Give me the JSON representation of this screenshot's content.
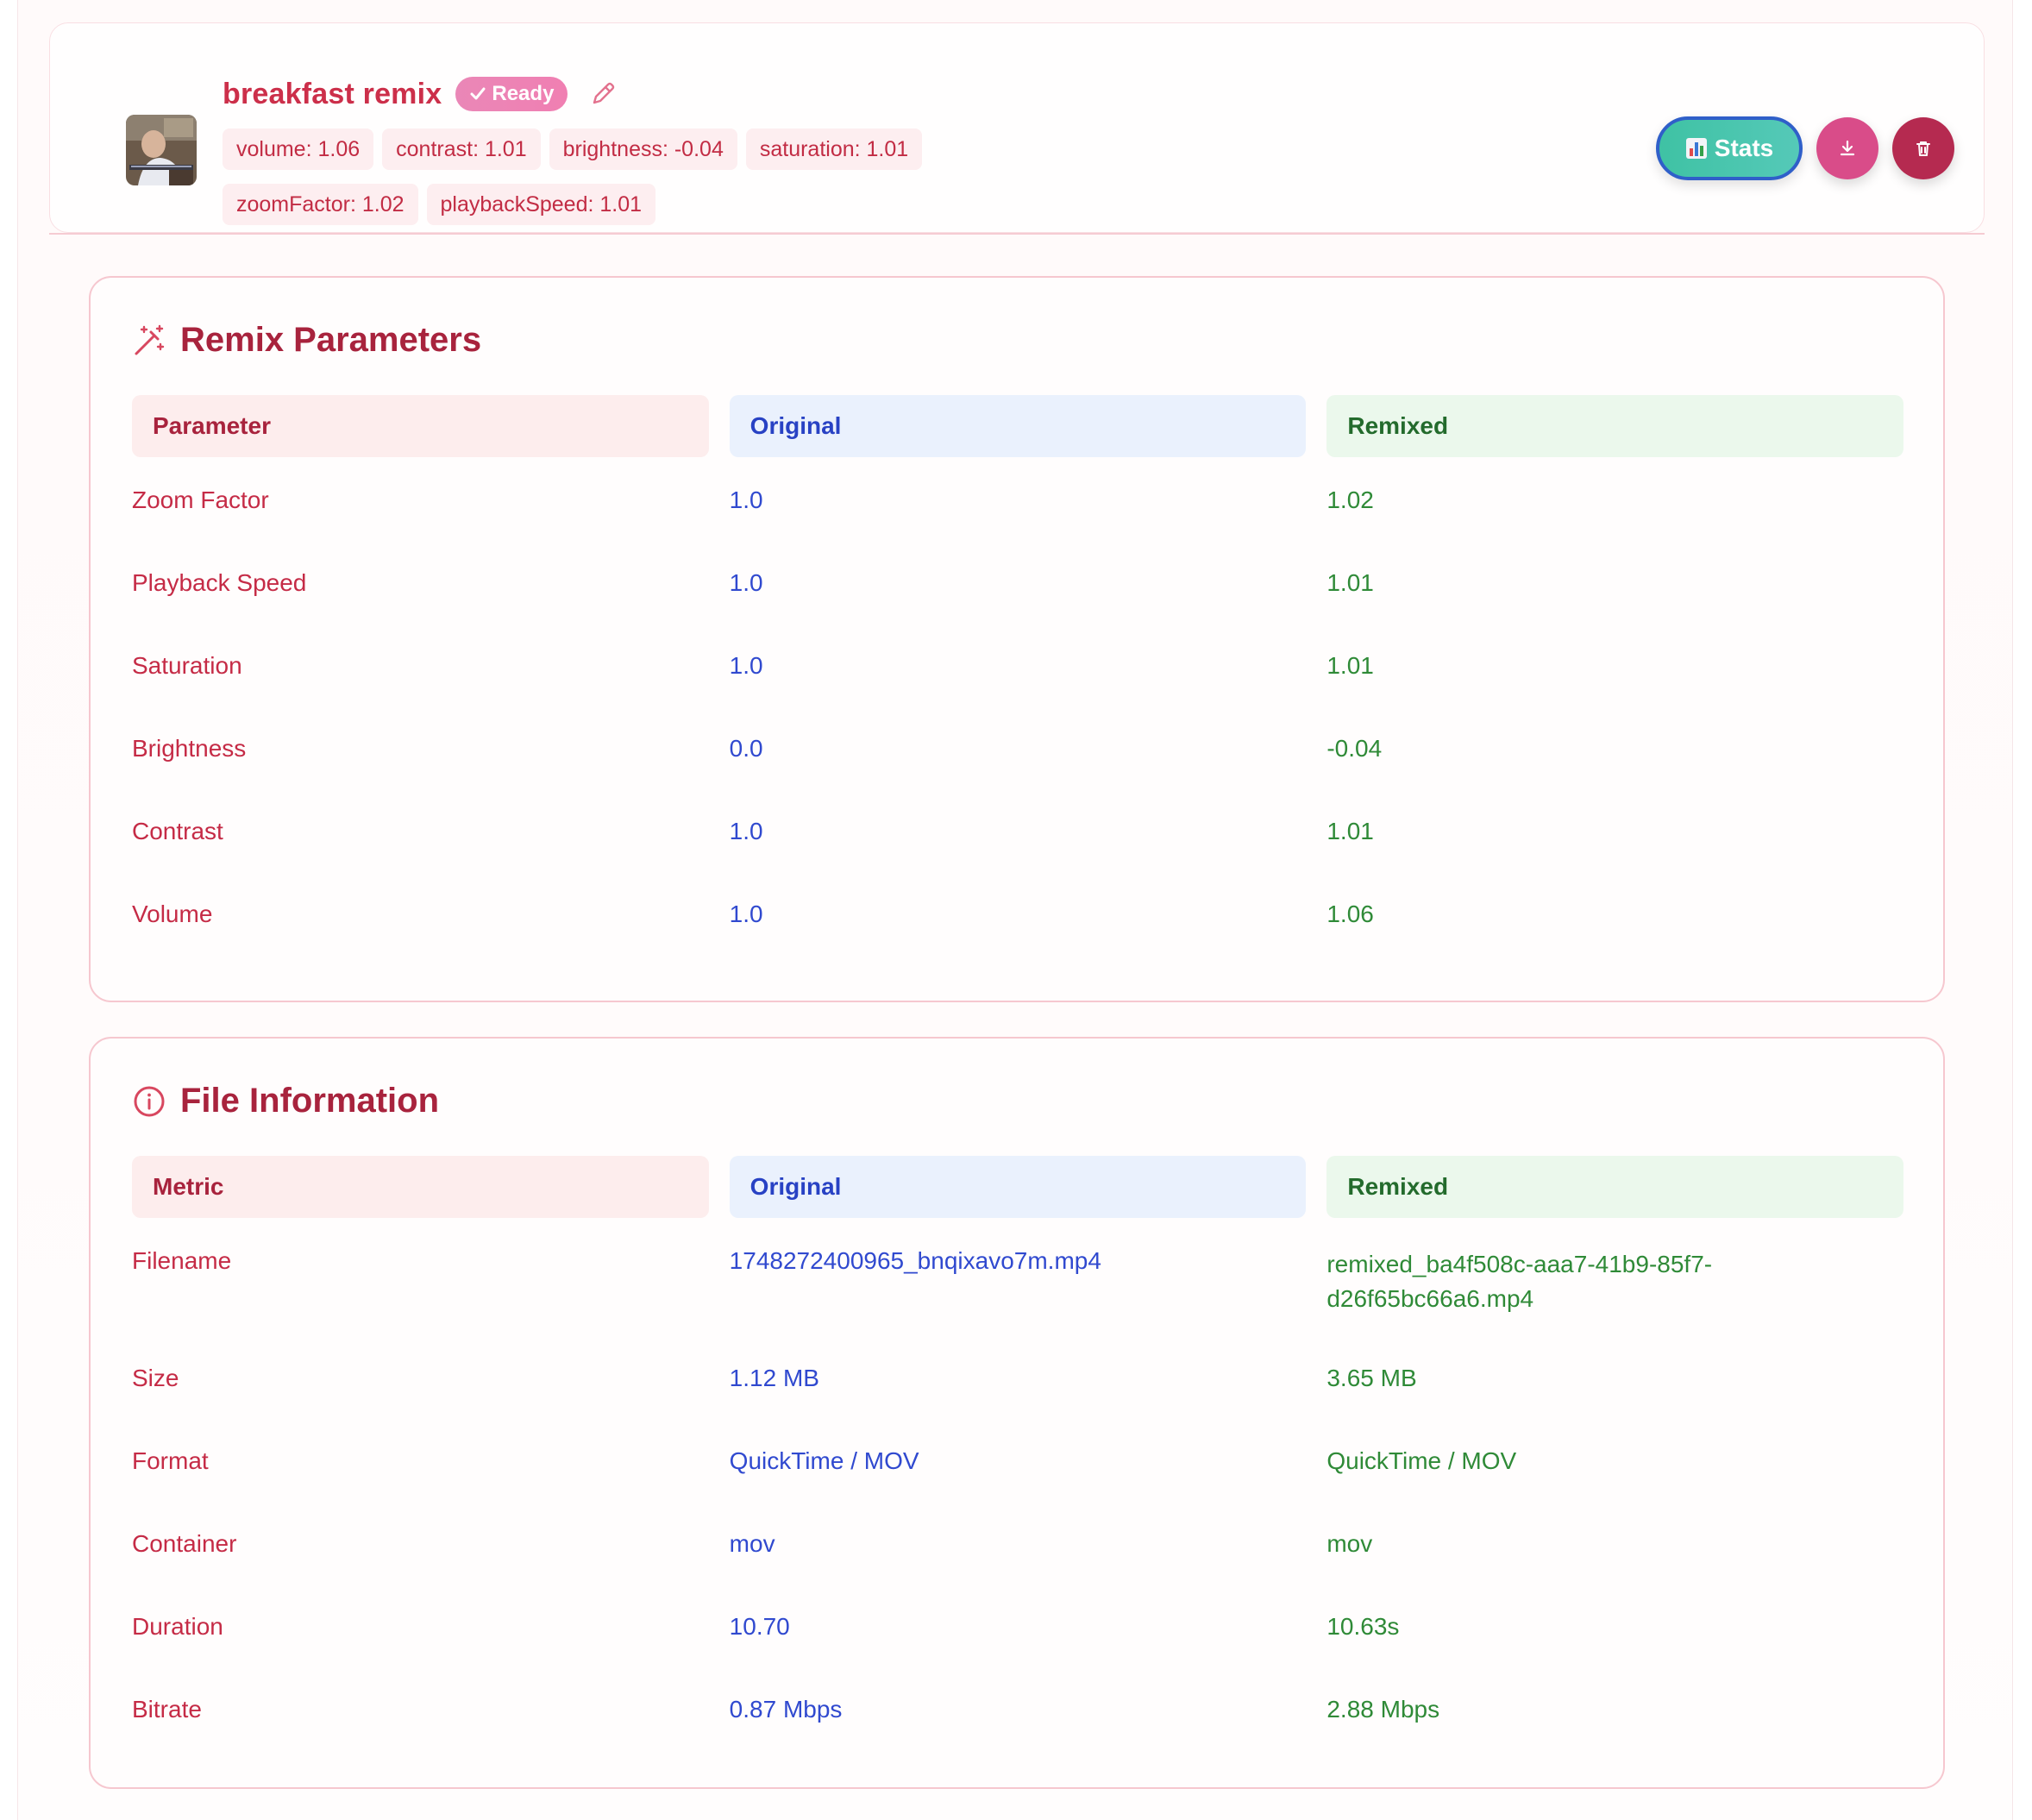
{
  "item": {
    "title": "breakfast remix",
    "status": "Ready",
    "status_icon": "check-icon",
    "chips": [
      "volume: 1.06",
      "contrast: 1.01",
      "brightness: -0.04",
      "saturation: 1.01",
      "zoomFactor: 1.02",
      "playbackSpeed: 1.01"
    ],
    "actions": {
      "stats_label": "Stats",
      "stats_icon": "bar-chart-icon",
      "download_icon": "download-icon",
      "delete_icon": "trash-icon"
    }
  },
  "remix_parameters": {
    "title": "Remix Parameters",
    "icon": "magic-wand-icon",
    "headers": {
      "param": "Parameter",
      "original": "Original",
      "remixed": "Remixed"
    },
    "rows": [
      {
        "name": "Zoom Factor",
        "original": "1.0",
        "remixed": "1.02"
      },
      {
        "name": "Playback Speed",
        "original": "1.0",
        "remixed": "1.01"
      },
      {
        "name": "Saturation",
        "original": "1.0",
        "remixed": "1.01"
      },
      {
        "name": "Brightness",
        "original": "0.0",
        "remixed": "-0.04"
      },
      {
        "name": "Contrast",
        "original": "1.0",
        "remixed": "1.01"
      },
      {
        "name": "Volume",
        "original": "1.0",
        "remixed": "1.06"
      }
    ]
  },
  "file_information": {
    "title": "File Information",
    "icon": "info-icon",
    "headers": {
      "param": "Metric",
      "original": "Original",
      "remixed": "Remixed"
    },
    "rows": [
      {
        "name": "Filename",
        "original": "1748272400965_bnqixavo7m.mp4",
        "remixed_line1": "remixed_ba4f508c-aaa7-41b9-85f7-",
        "remixed_line2": "d26f65bc66a6.mp4"
      },
      {
        "name": "Size",
        "original": "1.12 MB",
        "remixed": "3.65 MB"
      },
      {
        "name": "Format",
        "original": "QuickTime / MOV",
        "remixed": "QuickTime / MOV"
      },
      {
        "name": "Container",
        "original": "mov",
        "remixed": "mov"
      },
      {
        "name": "Duration",
        "original": "10.70",
        "remixed": "10.63s"
      },
      {
        "name": "Bitrate",
        "original": "0.87 Mbps",
        "remixed": "2.88 Mbps"
      }
    ]
  },
  "colors": {
    "title": "#cc2f4a",
    "original": "#3049cf",
    "remixed": "#2f8a37",
    "stats_button": "#3fc2a4",
    "download_button": "#d94c89",
    "delete_button": "#b52a50"
  }
}
